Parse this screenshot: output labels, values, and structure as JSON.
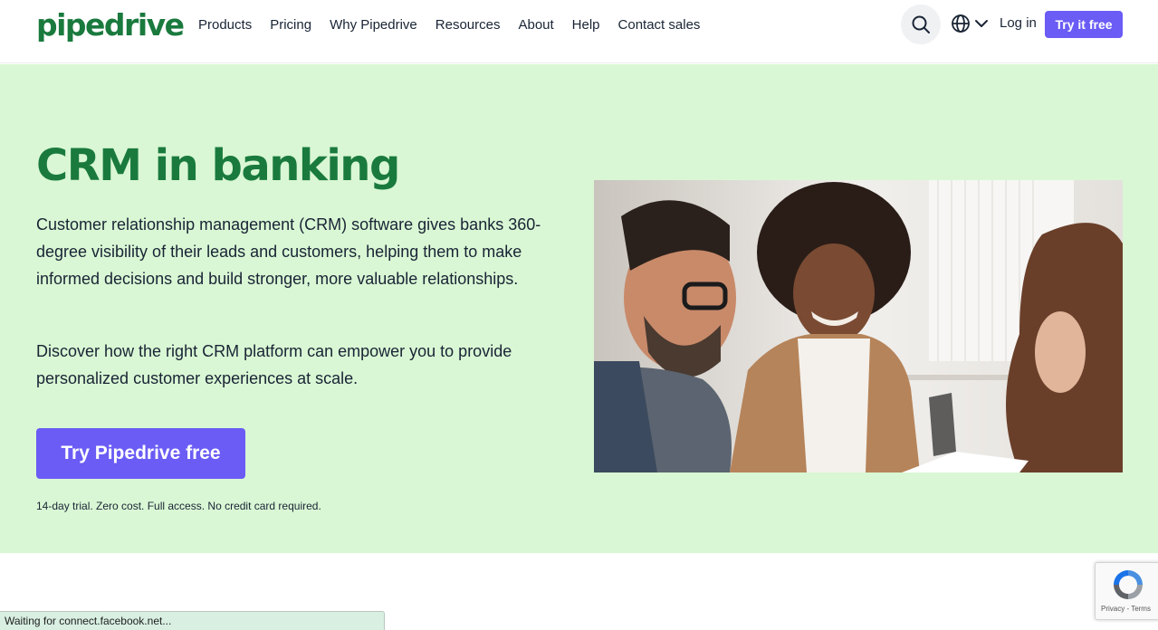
{
  "header": {
    "logo": "pipedrive",
    "nav": [
      "Products",
      "Pricing",
      "Why Pipedrive",
      "Resources",
      "About",
      "Help",
      "Contact sales"
    ],
    "login": "Log in",
    "try_free": "Try it free"
  },
  "hero": {
    "title": "CRM in banking",
    "p1": "Customer relationship management (CRM) software gives banks 360-degree visibility of their leads and customers, helping them to make informed decisions and build stronger, more valuable relationships.",
    "p2": "Discover how the right CRM platform can empower you to provide personalized customer experiences at scale.",
    "cta": "Try Pipedrive free",
    "trial_note": "14-day trial. Zero cost. Full access. No credit card required."
  },
  "status_bar": "Waiting for connect.facebook.net...",
  "recaptcha": {
    "links": "Privacy - Terms"
  },
  "colors": {
    "brand_green": "#1a7a3e",
    "hero_bg": "#d9f7d4",
    "accent_purple": "#6a5cf5"
  },
  "icons": {
    "search": "search-icon",
    "language": "globe-icon",
    "chevron": "chevron-down-icon",
    "recaptcha": "recaptcha-icon"
  }
}
